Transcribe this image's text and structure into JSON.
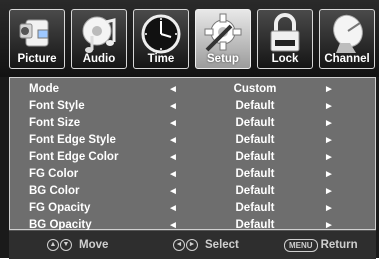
{
  "tabs": [
    {
      "label": "Picture",
      "icon": "camcorder-icon",
      "active": false
    },
    {
      "label": "Audio",
      "icon": "music-note-icon",
      "active": false
    },
    {
      "label": "Time",
      "icon": "clock-icon",
      "active": false
    },
    {
      "label": "Setup",
      "icon": "gear-icon",
      "active": true
    },
    {
      "label": "Lock",
      "icon": "padlock-icon",
      "active": false
    },
    {
      "label": "Channel",
      "icon": "satellite-dish-icon",
      "active": false
    }
  ],
  "menu": {
    "left_arrow": "◄",
    "right_arrow": "►",
    "rows": [
      {
        "name": "Mode",
        "value": "Custom"
      },
      {
        "name": "Font Style",
        "value": "Default"
      },
      {
        "name": "Font  Size",
        "value": "Default"
      },
      {
        "name": "Font  Edge Style",
        "value": "Default"
      },
      {
        "name": "Font Edge Color",
        "value": "Default"
      },
      {
        "name": "FG  Color",
        "value": "Default"
      },
      {
        "name": "BG  Color",
        "value": "Default"
      },
      {
        "name": "FG  Opacity",
        "value": "Default"
      },
      {
        "name": "BG  Opacity",
        "value": "Default"
      }
    ]
  },
  "footer": {
    "move_label": "Move",
    "select_label": "Select",
    "return_label": "Return",
    "menu_key": "MENU",
    "up_glyph": "▲",
    "down_glyph": "▼",
    "left_glyph": "◄",
    "right_glyph": "►"
  },
  "colors": {
    "panel_bg": "#6e6e6e",
    "frame_bg": "#1a1a1a",
    "active_tab": "#c8c8c8"
  }
}
